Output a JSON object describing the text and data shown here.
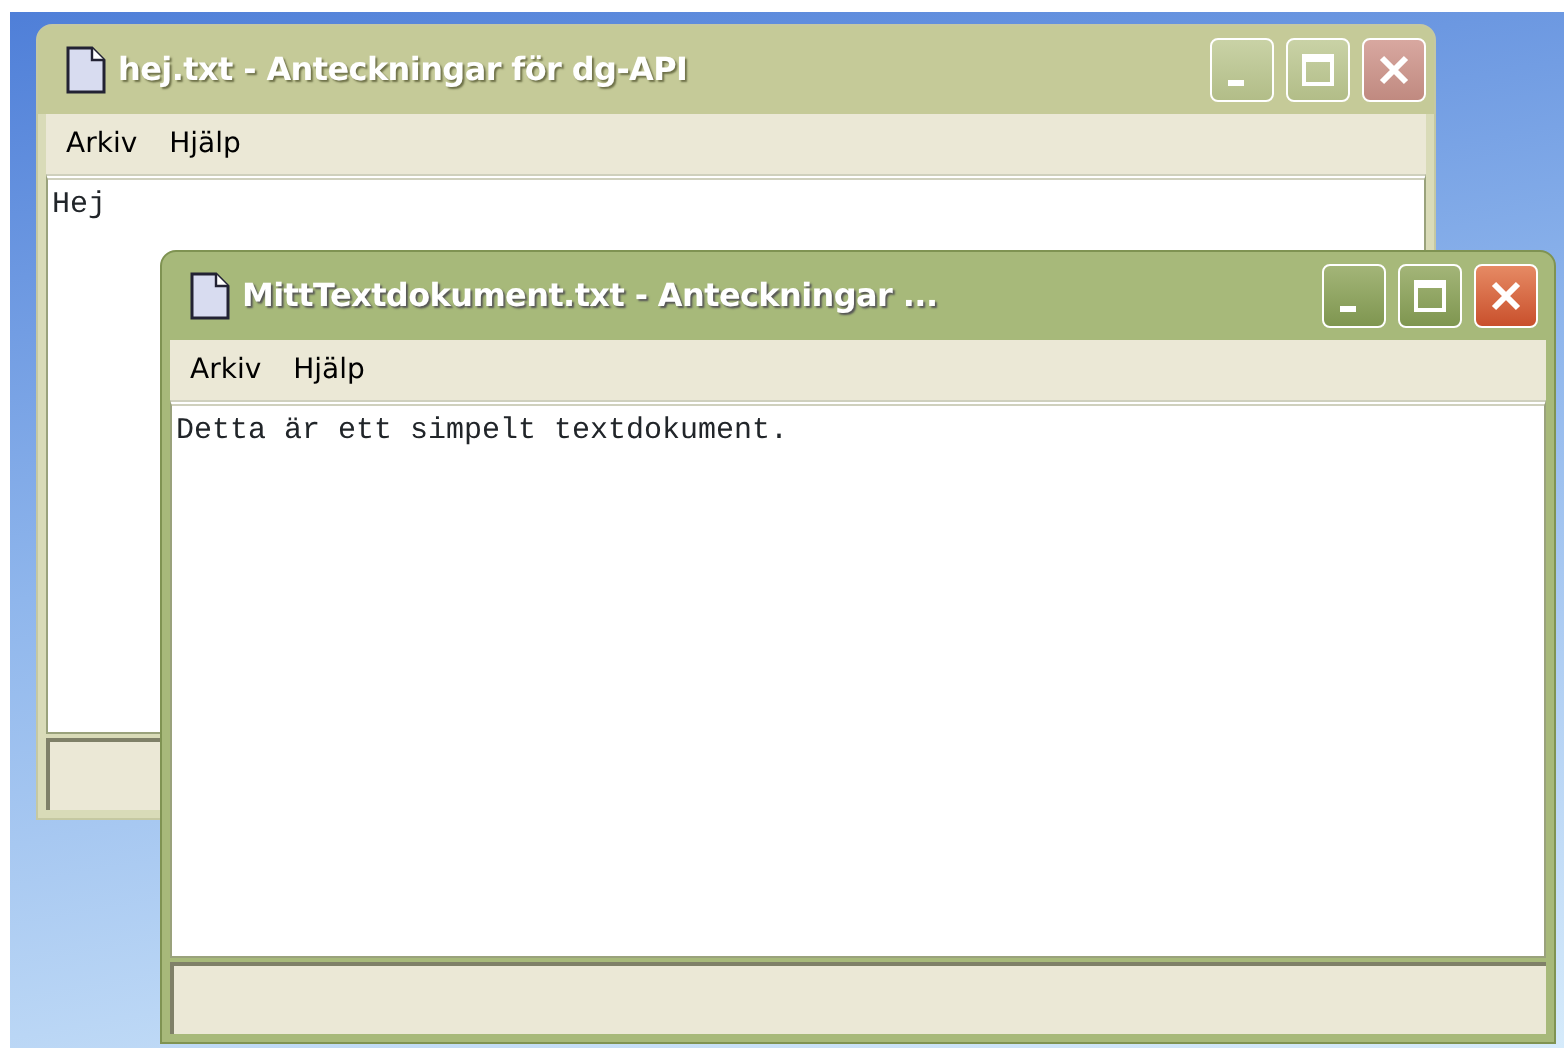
{
  "windows": [
    {
      "title": "hej.txt - Anteckningar för dg-API",
      "active": false,
      "menu": [
        "Arkiv",
        "Hjälp"
      ],
      "text": "Hej"
    },
    {
      "title": "MittTextdokument.txt - Anteckningar ...",
      "active": true,
      "menu": [
        "Arkiv",
        "Hjälp"
      ],
      "text": "Detta är ett simpelt textdokument."
    }
  ]
}
